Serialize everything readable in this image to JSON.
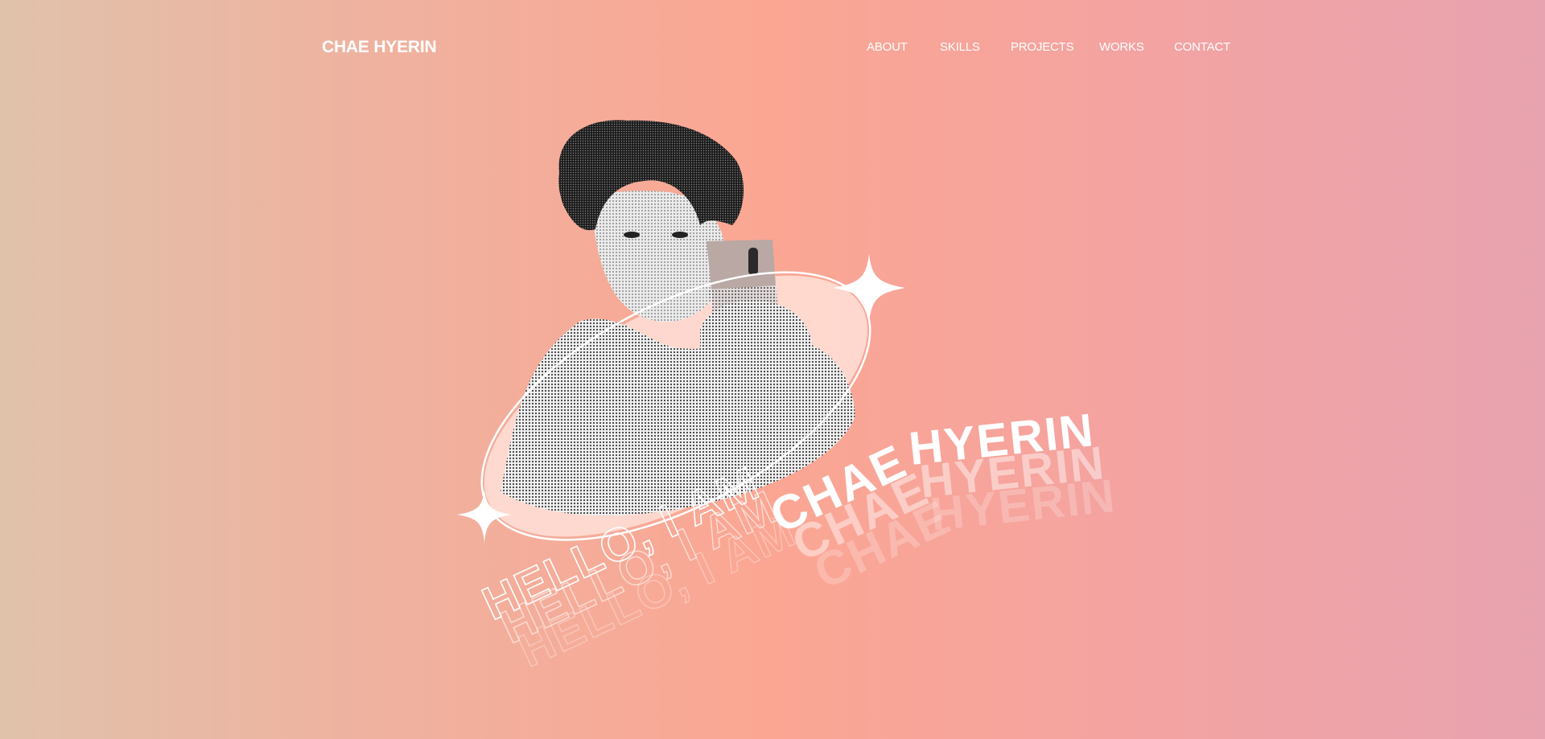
{
  "header": {
    "logo": "CHAE HYERIN",
    "nav": [
      {
        "id": "about",
        "label": "ABOUT"
      },
      {
        "id": "skills",
        "label": "SKILLS"
      },
      {
        "id": "projects",
        "label": "PROJECTS"
      },
      {
        "id": "works",
        "label": "WORKS"
      },
      {
        "id": "contact",
        "label": "CONTACT"
      }
    ]
  },
  "hero": {
    "greeting": "HELLO, I AM",
    "name_first": "CHAE",
    "name_last": "HYERIN",
    "portrait_icon": "portrait-photo-icon",
    "sparkle_icon": "sparkle-star-icon"
  },
  "colors": {
    "text": "#ffffff",
    "gradient_left": "#e0c2ab",
    "gradient_mid": "#fba693",
    "gradient_right": "#e8a3b0"
  }
}
